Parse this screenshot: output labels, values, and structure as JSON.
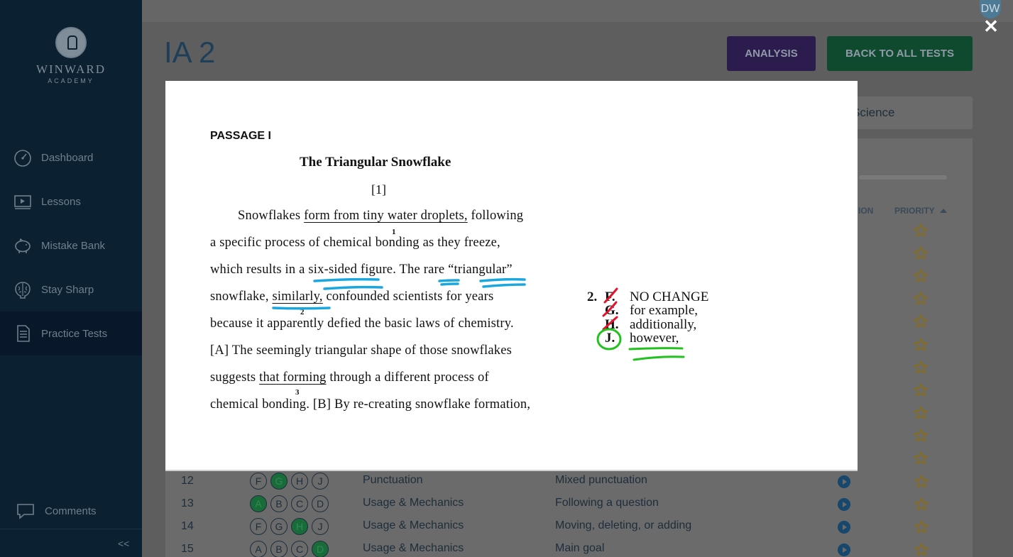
{
  "brand": {
    "name": "WINWARD",
    "sub": "ACADEMY"
  },
  "sidebar": {
    "items": [
      {
        "label": "Dashboard",
        "icon": "gauge-icon"
      },
      {
        "label": "Lessons",
        "icon": "video-icon"
      },
      {
        "label": "Mistake Bank",
        "icon": "piggy-bank-icon"
      },
      {
        "label": "Stay Sharp",
        "icon": "brain-icon"
      },
      {
        "label": "Practice Tests",
        "icon": "document-icon",
        "active": true
      }
    ],
    "comments": "Comments",
    "collapse": "<<"
  },
  "header": {
    "avatar": "DW",
    "title": "IA 2",
    "analysis_button": "ANALYSIS",
    "back_button": "BACK TO ALL TESTS",
    "close": "✕"
  },
  "tabs": {
    "visible_tab": "Science"
  },
  "table": {
    "col_partial": "ION",
    "col_priority": "PRIORITY",
    "rows": [
      {
        "num": "12",
        "choices": [
          "F",
          "G",
          "H",
          "J"
        ],
        "correct": 1,
        "category": "Punctuation",
        "subcategory": "Mixed punctuation"
      },
      {
        "num": "13",
        "choices": [
          "A",
          "B",
          "C",
          "D"
        ],
        "correct": 0,
        "category": "Usage & Mechanics",
        "subcategory": "Following a question"
      },
      {
        "num": "14",
        "choices": [
          "F",
          "G",
          "H",
          "J"
        ],
        "correct": 2,
        "category": "Usage & Mechanics",
        "subcategory": "Moving, deleting, or adding"
      },
      {
        "num": "15",
        "choices": [
          "A",
          "B",
          "C",
          "D"
        ],
        "correct": 3,
        "category": "Usage & Mechanics",
        "subcategory": "Main goal"
      }
    ]
  },
  "modal": {
    "passage_label": "PASSAGE I",
    "title": "The Triangular Snowflake",
    "para_num": "[1]",
    "lines": {
      "l1a": "Snowflakes ",
      "l1u": "form from tiny water droplets,",
      "l1b": " following",
      "l2": "a specific process of chemical bonding as they freeze,",
      "l3": "which results in a six-sided figure. The rare “triangular”",
      "l4a": "snowflake, ",
      "l4u": "similarly,",
      "l4b": " confounded scientists for years",
      "l5": "because it apparently defied the basic laws of chemistry.",
      "l6": "[A] The seemingly triangular shape of those snowflakes",
      "l7a": "suggests ",
      "l7u": "that forming",
      "l7b": " through a different process of",
      "l8": "chemical bonding. [B] By re-creating snowflake formation,"
    },
    "footnotes": [
      "1",
      "2",
      "3"
    ],
    "question": {
      "number": "2.",
      "options": [
        {
          "letter": "F.",
          "text": "NO CHANGE"
        },
        {
          "letter": "G.",
          "text": "for example,"
        },
        {
          "letter": "H.",
          "text": "additionally,"
        },
        {
          "letter": "J.",
          "text": "however,"
        }
      ]
    }
  },
  "colors": {
    "sidebar_bg": "#0b2030",
    "annotation_blue": "#1aa7e0",
    "annotation_red": "#e0142a",
    "annotation_green": "#22c21e"
  }
}
